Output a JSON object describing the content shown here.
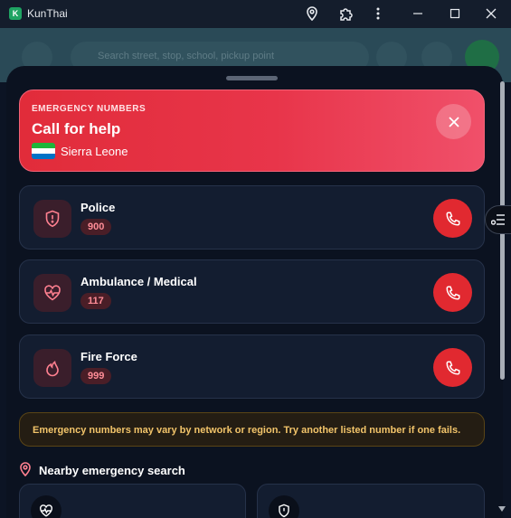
{
  "window": {
    "app_initial": "K",
    "title": "KunThai"
  },
  "background": {
    "search_placeholder": "Search street, stop, school, pickup point"
  },
  "emergency": {
    "eyebrow": "EMERGENCY NUMBERS",
    "title": "Call for help",
    "country": "Sierra Leone",
    "flag_colors": [
      "#1eb53a",
      "#ffffff",
      "#0072c6"
    ],
    "accent": "#e12c3a"
  },
  "services": [
    {
      "name": "Police",
      "number": "900",
      "icon": "shield-alert-icon"
    },
    {
      "name": "Ambulance / Medical",
      "number": "117",
      "icon": "heart-pulse-icon"
    },
    {
      "name": "Fire Force",
      "number": "999",
      "icon": "flame-icon"
    }
  ],
  "notice": {
    "text": "Emergency numbers may vary by network or region. Try another listed number if one fails."
  },
  "nearby": {
    "title": "Nearby emergency search"
  }
}
